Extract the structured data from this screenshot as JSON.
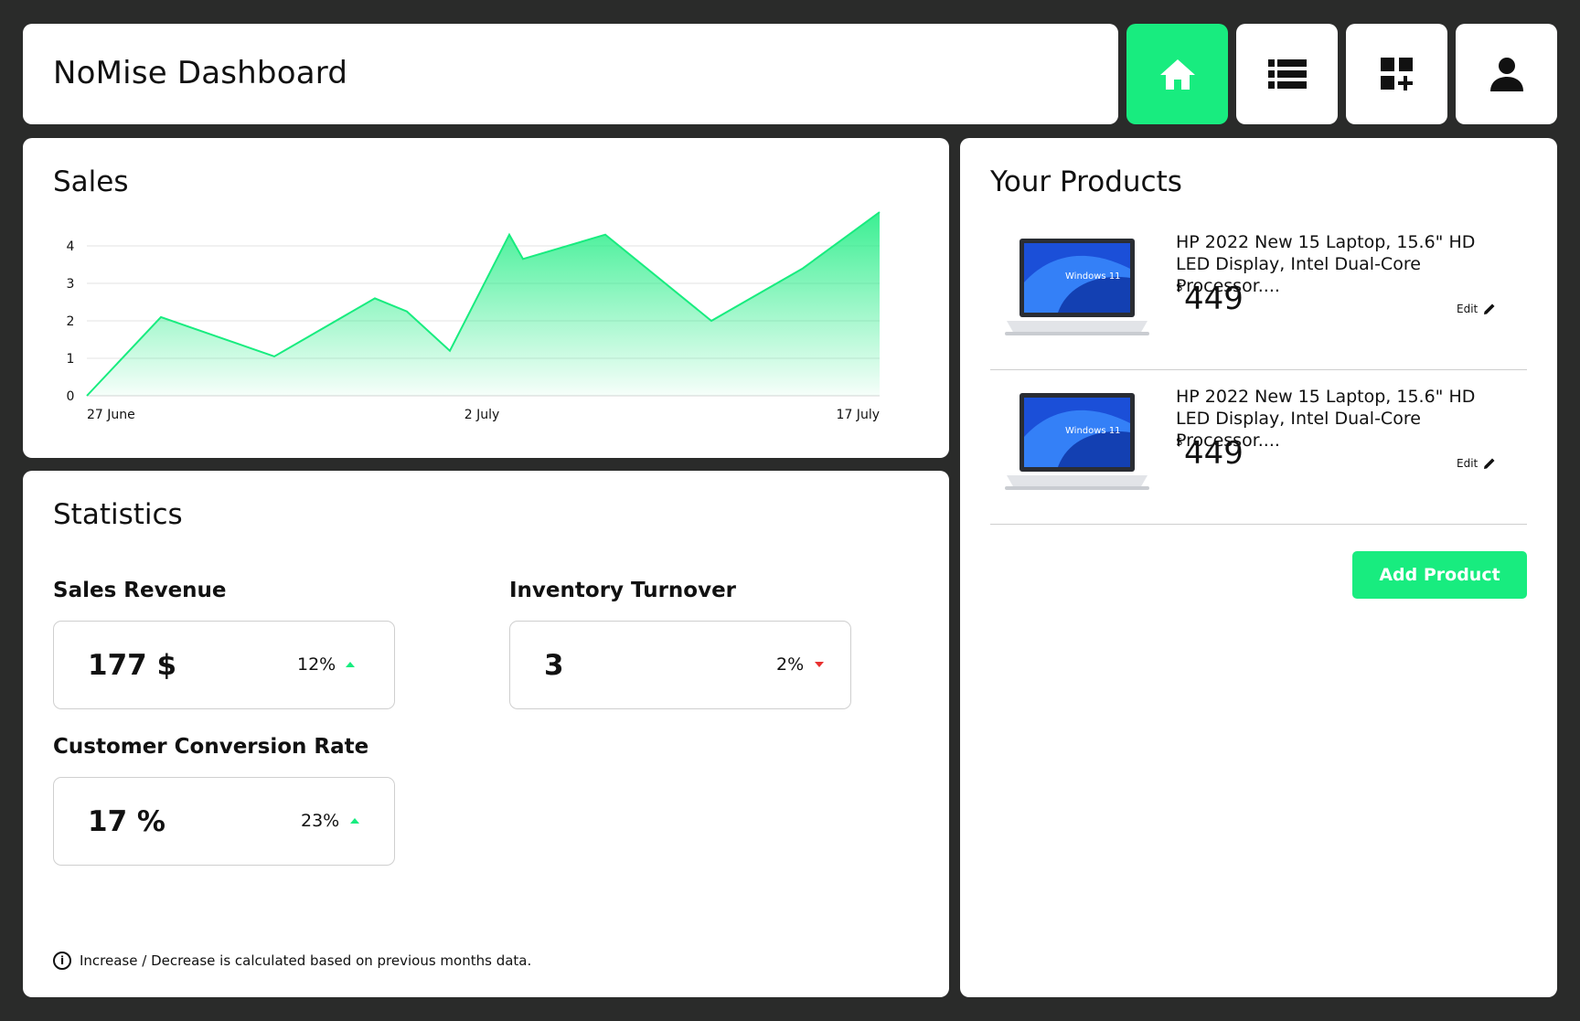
{
  "header": {
    "title": "NoMise Dashboard",
    "nav": [
      {
        "id": "home",
        "icon": "home-icon",
        "active": true
      },
      {
        "id": "list",
        "icon": "list-icon",
        "active": false
      },
      {
        "id": "add",
        "icon": "dashboard-add-icon",
        "active": false
      },
      {
        "id": "user",
        "icon": "user-icon",
        "active": false
      }
    ]
  },
  "sales": {
    "title": "Sales"
  },
  "chart_data": {
    "type": "area",
    "title": "Sales",
    "xlabel": "",
    "ylabel": "",
    "ylim": [
      0,
      4
    ],
    "yticks": [
      "0",
      "1",
      "2",
      "3",
      "4"
    ],
    "xticks": [
      "27 June",
      "2 July",
      "17 July"
    ],
    "grid": true,
    "color": "#18ec7f",
    "series": [
      {
        "values": [
          0,
          2.1,
          1.05,
          2.6,
          2.25,
          1.2,
          4.3,
          3.65,
          4.3,
          2.0,
          3.4,
          4.9
        ]
      }
    ]
  },
  "statistics": {
    "title": "Statistics",
    "sales_revenue": {
      "label": "Sales Revenue",
      "value": "177 $",
      "change": "12%",
      "direction": "up"
    },
    "inventory_turnover": {
      "label": "Inventory Turnover",
      "value": "3",
      "change": "2%",
      "direction": "down"
    },
    "conversion_rate": {
      "label": "Customer Conversion Rate",
      "value": "17 %",
      "change": "23%",
      "direction": "up"
    },
    "note": "Increase / Decrease is calculated based on previous months data.",
    "colors": {
      "up": "#18ec7f",
      "down": "#e8302f"
    }
  },
  "products": {
    "title": "Your Products",
    "items": [
      {
        "name": "HP 2022 New 15 Laptop, 15.6\" HD LED Display, Intel Dual-Core Processor....",
        "currency": "$",
        "price": "449",
        "edit_label": "Edit",
        "screen_text": "Windows 11"
      },
      {
        "name": "HP 2022 New 15 Laptop, 15.6\" HD LED Display, Intel Dual-Core Processor....",
        "currency": "$",
        "price": "449",
        "edit_label": "Edit",
        "screen_text": "Windows 11"
      }
    ],
    "add_label": "Add Product"
  },
  "brand_color": "#18ec7f"
}
